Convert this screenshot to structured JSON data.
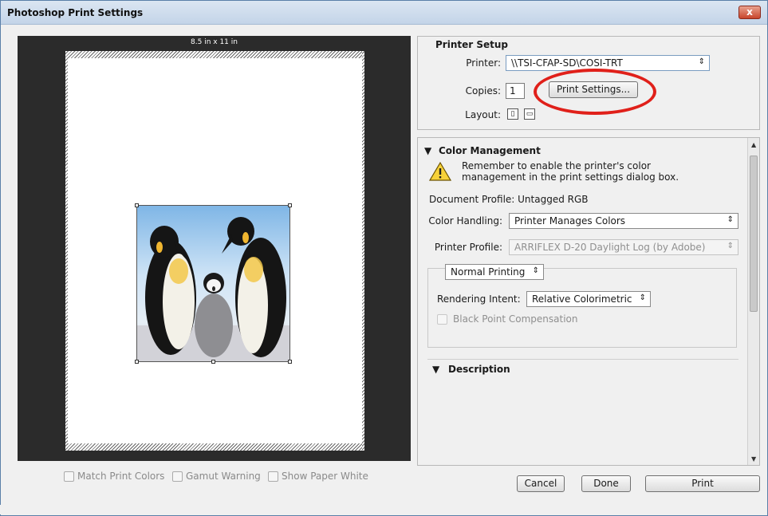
{
  "window": {
    "title": "Photoshop Print Settings",
    "close_label": "x"
  },
  "preview": {
    "paper_size": "8.5 in x 11 in",
    "image_alt": "emperor penguins"
  },
  "preview_options": [
    {
      "label": "Match Print Colors",
      "checked": false
    },
    {
      "label": "Gamut Warning",
      "checked": false
    },
    {
      "label": "Show Paper White",
      "checked": false
    }
  ],
  "printer_setup": {
    "title": "Printer Setup",
    "printer_label": "Printer:",
    "printer_value": "\\\\TSI-CFAP-SD\\COSI-TRT",
    "copies_label": "Copies:",
    "copies_value": "1",
    "print_settings_button": "Print Settings...",
    "layout_label": "Layout:",
    "highlight_color": "#e0201a"
  },
  "color_management": {
    "title": "Color Management",
    "warning_text_line1": "Remember to enable the printer's color",
    "warning_text_line2": "management in the print settings dialog box.",
    "document_profile": "Document Profile: Untagged RGB",
    "color_handling_label": "Color Handling:",
    "color_handling_value": "Printer Manages Colors",
    "printer_profile_label": "Printer Profile:",
    "printer_profile_value": "ARRIFLEX D-20 Daylight Log (by Adobe)",
    "normal_printing": "Normal Printing",
    "rendering_intent_label": "Rendering Intent:",
    "rendering_intent_value": "Relative Colorimetric",
    "black_point_label": "Black Point Compensation",
    "black_point_checked": false
  },
  "description": {
    "title": "Description"
  },
  "footer": {
    "cancel": "Cancel",
    "done": "Done",
    "print": "Print"
  }
}
